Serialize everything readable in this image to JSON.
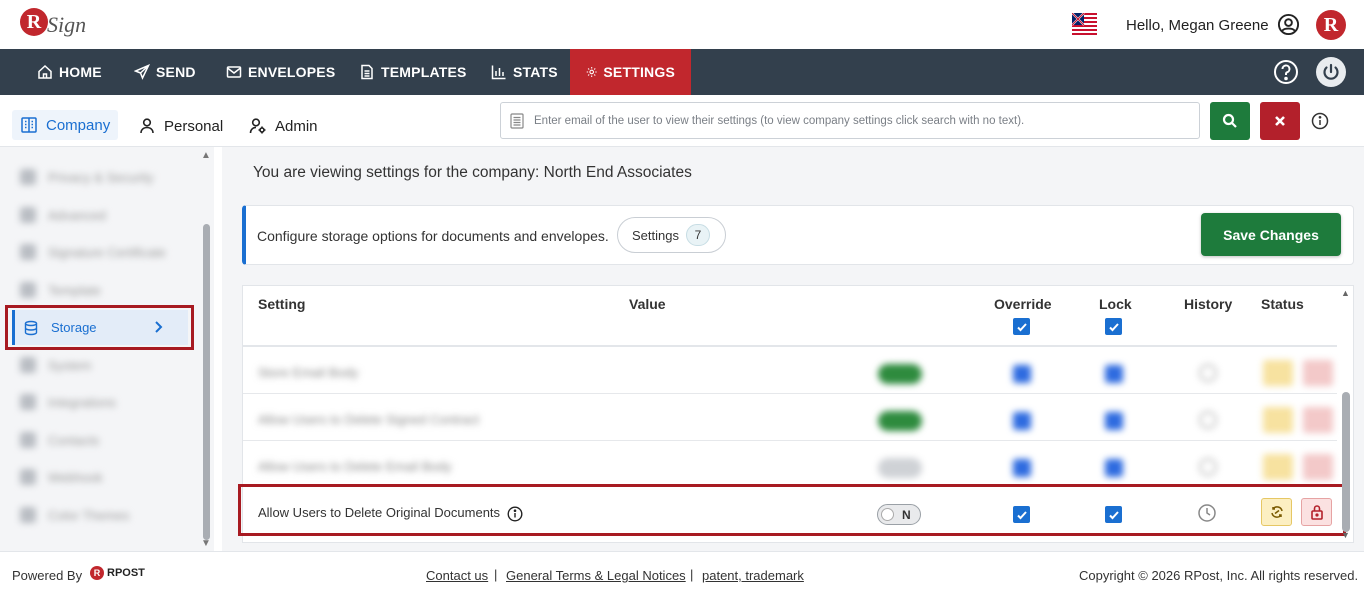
{
  "header": {
    "logo_letter": "R",
    "logo_text": "Sign",
    "greeting": "Hello, Megan Greene",
    "badge_letter": "R"
  },
  "nav": {
    "items": [
      {
        "label": "HOME",
        "icon": "home-icon"
      },
      {
        "label": "SEND",
        "icon": "send-icon"
      },
      {
        "label": "ENVELOPES",
        "icon": "envelope-icon"
      },
      {
        "label": "TEMPLATES",
        "icon": "template-icon"
      },
      {
        "label": "STATS",
        "icon": "stats-icon"
      },
      {
        "label": "SETTINGS",
        "icon": "gear-icon",
        "active": true
      }
    ]
  },
  "subnav": {
    "tabs": [
      {
        "label": "Company",
        "active": true
      },
      {
        "label": "Personal"
      },
      {
        "label": "Admin"
      }
    ],
    "search_placeholder": "Enter email of the user to view their settings (to view company settings click search with no text)."
  },
  "sidebar": {
    "active_item": "Storage"
  },
  "main": {
    "viewing_text": "You are viewing settings for the company: North End Associates",
    "description": "Configure storage options for documents and envelopes.",
    "settings_chip_label": "Settings",
    "settings_count": "7",
    "save_label": "Save Changes"
  },
  "table": {
    "columns": {
      "setting": "Setting",
      "value": "Value",
      "override": "Override",
      "lock": "Lock",
      "history": "History",
      "status": "Status"
    },
    "highlighted_row": {
      "label": "Allow Users to Delete Original Documents",
      "toggle_text": "N",
      "override": true,
      "lock": true
    }
  },
  "footer": {
    "powered_by": "Powered By",
    "brand": "RPOST",
    "links": [
      "Contact us",
      "General Terms & Legal Notices",
      "patent, trademark"
    ],
    "copyright": "Copyright © 2026 RPost, Inc. All rights reserved."
  },
  "colors": {
    "nav_bg": "#33404d",
    "accent_red": "#c1272d",
    "accent_blue": "#1a6fd1",
    "save_green": "#1e7b3c",
    "highlight_border": "#a71a21"
  }
}
